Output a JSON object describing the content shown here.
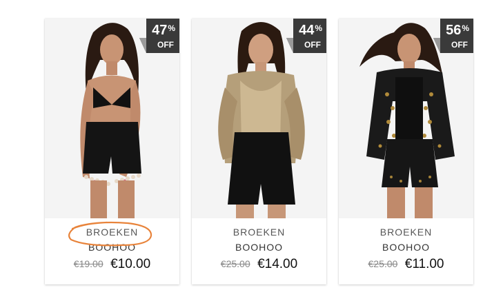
{
  "colors": {
    "badge_bg": "#3a3a3a",
    "badge_fold": "#9a9a9a",
    "annotation": "#e8833a"
  },
  "products": [
    {
      "discount_number": "47",
      "discount_percent_sign": "%",
      "discount_off": "OFF",
      "category": "BROEKEN",
      "brand": "BOOHOO",
      "old_price": "€19.00",
      "new_price": "€10.00",
      "image_icon": "model-photo-bikini-tassel-shorts"
    },
    {
      "discount_number": "44",
      "discount_percent_sign": "%",
      "discount_off": "OFF",
      "category": "BROEKEN",
      "brand": "BOOHOO",
      "old_price": "€25.00",
      "new_price": "€14.00",
      "image_icon": "model-photo-satin-shirt-black-shorts"
    },
    {
      "discount_number": "56",
      "discount_percent_sign": "%",
      "discount_off": "OFF",
      "category": "BROEKEN",
      "brand": "BOOHOO",
      "old_price": "€25.00",
      "new_price": "€11.00",
      "image_icon": "model-photo-embellished-jacket-shorts"
    }
  ]
}
